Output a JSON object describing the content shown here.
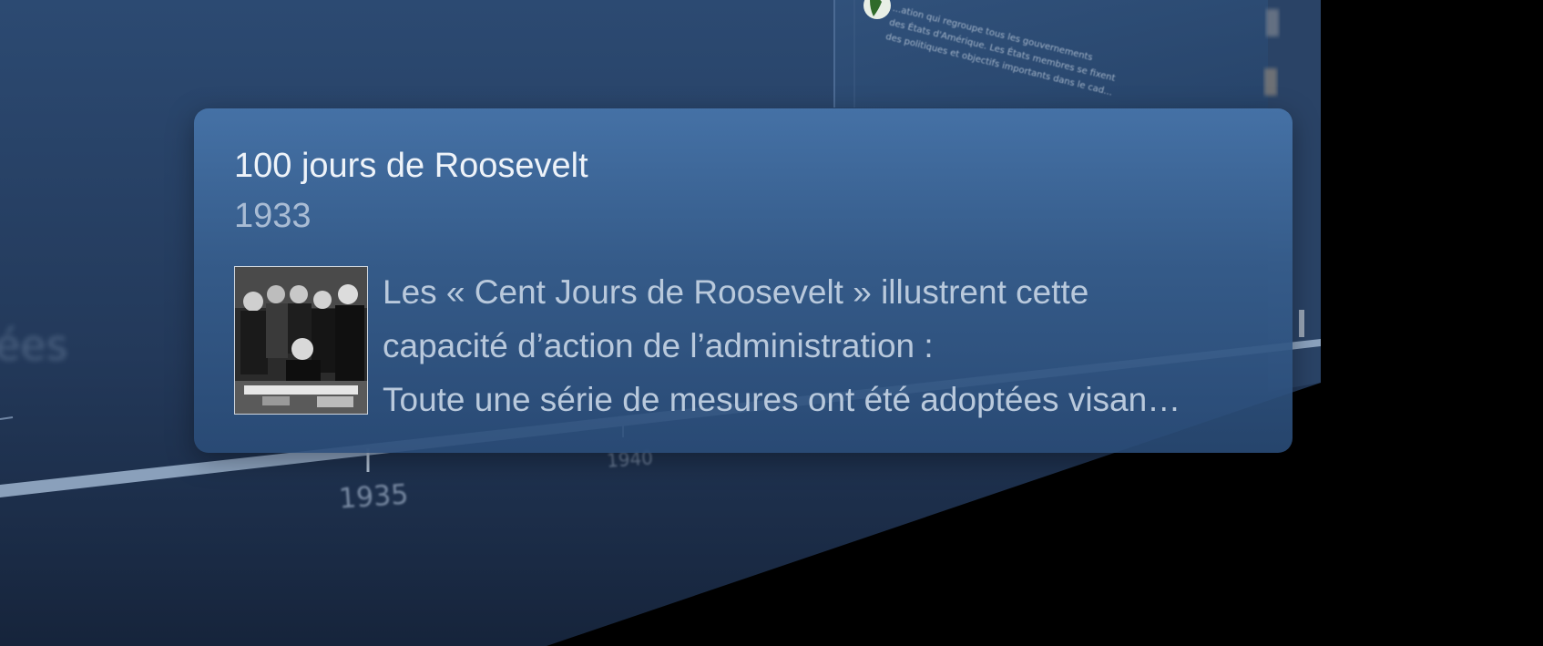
{
  "timeline": {
    "axis_labels": [
      "1935",
      "1940"
    ],
    "blurred_side_text": "ées"
  },
  "background_card": {
    "text_lines": [
      "...ation qui regroupe tous les gouvernements",
      "des États d'Amérique. Les États membres se fixent",
      "des politiques et objectifs importants dans le cad..."
    ],
    "icon": "globe-americas-icon"
  },
  "tooltip": {
    "title": "100 jours de Roosevelt",
    "year": "1933",
    "thumbnail": "roosevelt-signing-photo",
    "description_lines": [
      "Les « Cent Jours de Roosevelt » illustrent cette",
      "capacité d’action de l’administration :",
      "Toute une série de mesures ont été adoptées visan…"
    ]
  },
  "colors": {
    "background_panel": "#2a4468",
    "tooltip_bg": "#4673a8",
    "title_text": "#eef3f9",
    "year_text": "#a9bcd4",
    "description_text": "#b9c9dc"
  }
}
